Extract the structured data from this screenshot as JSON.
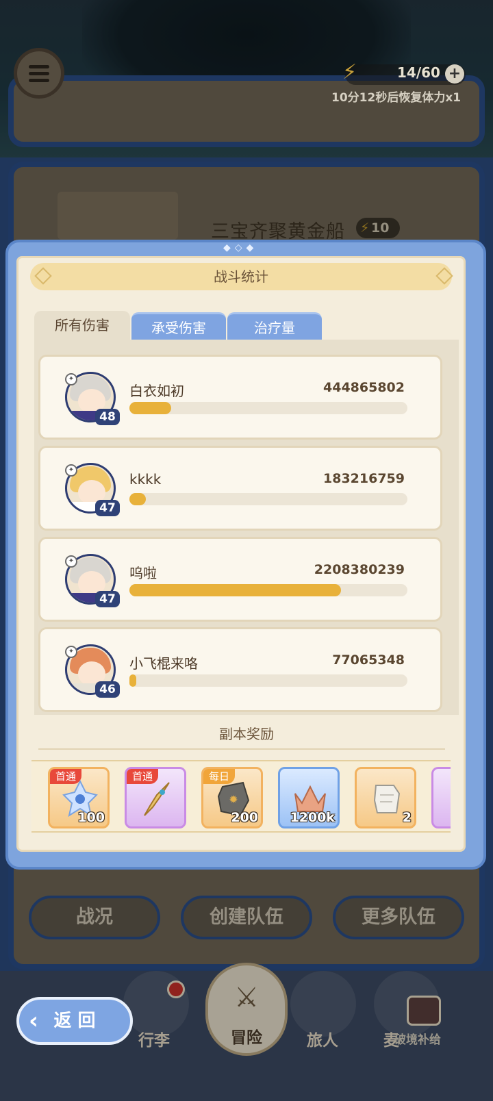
{
  "hud": {
    "stamina": "14/60",
    "stamina_plus": "+",
    "recover_text": "10分12秒后恢复体力x1"
  },
  "background": {
    "stage_title": "三宝齐聚黄金船",
    "stage_cost": "10",
    "buttons": [
      "战况",
      "创建队伍",
      "更多队伍"
    ]
  },
  "panel": {
    "title": "战斗统计",
    "tabs": [
      {
        "label": "所有伤害",
        "active": true
      },
      {
        "label": "承受伤害",
        "active": false
      },
      {
        "label": "治疗量",
        "active": false
      }
    ],
    "rows": [
      {
        "name": "白衣如初",
        "value": "444865802",
        "level": "48",
        "fraction": 0.15,
        "hair": "#d9d6d0",
        "cloak": "#3f3a86"
      },
      {
        "name": "kkkk",
        "value": "183216759",
        "level": "47",
        "fraction": 0.06,
        "hair": "#f0c86a",
        "cloak": "#ffffff"
      },
      {
        "name": "呜啦",
        "value": "2208380239",
        "level": "47",
        "fraction": 0.76,
        "hair": "#d9d6d0",
        "cloak": "#3f3a86"
      },
      {
        "name": "小飞棍来咯",
        "value": "77065348",
        "level": "46",
        "fraction": 0.025,
        "hair": "#e48b5a",
        "cloak": "#e7e2d6"
      }
    ],
    "reward_title": "副本奖励",
    "rewards": [
      {
        "tag": "首通",
        "qty": "100",
        "style": "orange",
        "icon": "crystal-icon"
      },
      {
        "tag": "首通",
        "qty": "",
        "style": "purple",
        "icon": "dagger-icon"
      },
      {
        "tag": "每日",
        "qty": "200",
        "style": "orange",
        "icon": "stone-icon"
      },
      {
        "tag": "",
        "qty": "1200k",
        "style": "blue",
        "icon": "crown-icon"
      },
      {
        "tag": "",
        "qty": "2",
        "style": "orange",
        "icon": "scroll-icon"
      }
    ]
  },
  "nav": {
    "items": [
      "行李",
      "冒险",
      "旅人",
      "麦"
    ],
    "back_label": "返 回",
    "shop_label": "破境补给"
  },
  "colors": {
    "bar_fill": "#e8b13a",
    "tab_active": "#e7dfcc",
    "tab_inactive": "#7fa4e1",
    "panel_frame": "#7ea4dd"
  }
}
